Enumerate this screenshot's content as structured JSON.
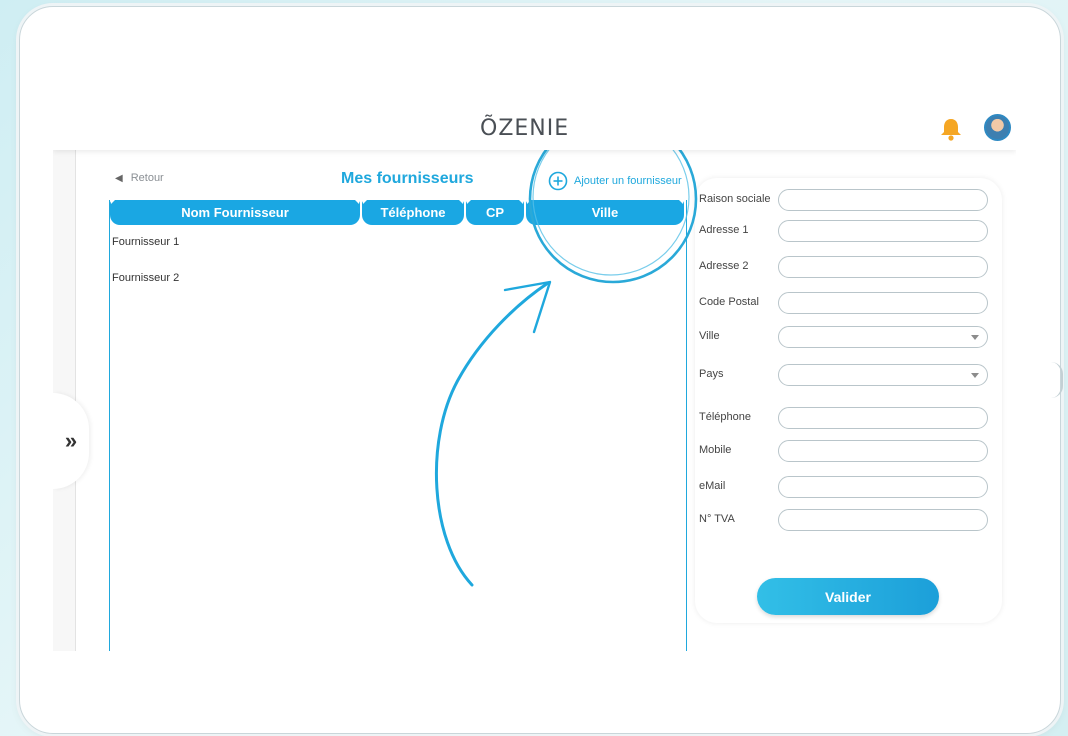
{
  "app": {
    "logo": "ÕZENIE"
  },
  "nav": {
    "back_label": "Retour",
    "sidebar_toggle": "»"
  },
  "page": {
    "title": "Mes fournisseurs",
    "add_label": "Ajouter un fournisseur"
  },
  "table": {
    "headers": [
      "Nom Fournisseur",
      "Téléphone",
      "CP",
      "Ville"
    ],
    "rows": [
      {
        "name": "Fournisseur 1"
      },
      {
        "name": "Fournisseur 2"
      }
    ]
  },
  "form": {
    "fields": [
      {
        "label": "Raison sociale",
        "value": ""
      },
      {
        "label": "Adresse 1",
        "value": ""
      },
      {
        "label": "Adresse 2",
        "value": ""
      },
      {
        "label": "Code Postal",
        "value": ""
      },
      {
        "label": "Ville",
        "value": ""
      },
      {
        "label": "Pays",
        "value": ""
      },
      {
        "label": "Téléphone",
        "value": ""
      },
      {
        "label": "Mobile",
        "value": ""
      },
      {
        "label": "eMail",
        "value": ""
      },
      {
        "label": "N° TVA",
        "value": ""
      }
    ],
    "submit_label": "Valider"
  },
  "colors": {
    "accent": "#1fa8dd",
    "header_bg": "#1aa7e3",
    "bell": "#f5a623"
  },
  "icons": {
    "notification": "bell-icon",
    "profile": "avatar",
    "add": "plus-circle-icon",
    "back": "triangle-left-icon",
    "dropdown": "chevron-down-icon"
  }
}
